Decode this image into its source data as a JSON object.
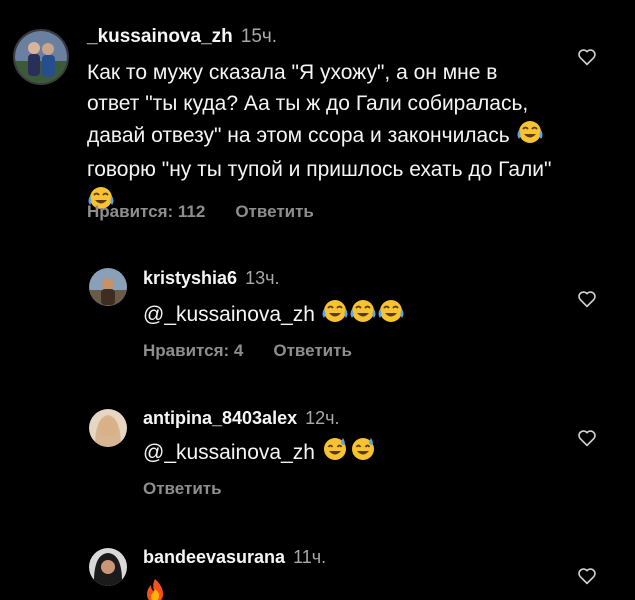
{
  "colors": {
    "background": "#000000",
    "text_primary": "#f5f5f5",
    "text_secondary": "#8e8e8e",
    "time": "#a8a8a8"
  },
  "comments": [
    {
      "username": "_kussainova_zh",
      "time": "15ч.",
      "text": "Как то мужу сказала \"Я ухожу\", а он мне в ответ \"ты куда? Аа ты ж до Гали собиралась, давай отвезу\" на этом ссора и закончилась",
      "text_tail": "говорю \"ну ты тупой и пришлось ехать до Гали\"",
      "likes_label": "Нравится: 112",
      "reply_label": "Ответить",
      "emoji": "joy-emoji"
    },
    {
      "username": "kristyshia6",
      "time": "13ч.",
      "text": "@_kussainova_zh",
      "likes_label": "Нравится: 4",
      "reply_label": "Ответить",
      "emoji": "joy-emoji"
    },
    {
      "username": "antipina_8403alex",
      "time": "12ч.",
      "text": "@_kussainova_zh",
      "reply_label": "Ответить",
      "emoji": "sweat-smile-emoji"
    },
    {
      "username": "bandeevasurana",
      "time": "11ч.",
      "emoji": "fire-emoji"
    }
  ]
}
